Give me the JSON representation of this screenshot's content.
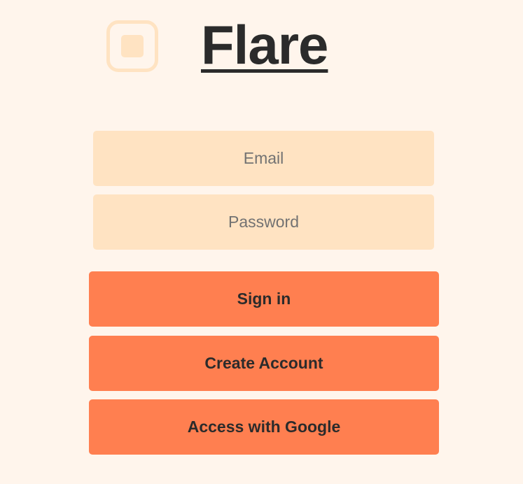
{
  "brand": {
    "name": "Flare",
    "icon": "rounded-square-icon"
  },
  "form": {
    "email_placeholder": "Email",
    "email_value": "",
    "password_placeholder": "Password",
    "password_value": ""
  },
  "buttons": {
    "sign_in": "Sign in",
    "create_account": "Create Account",
    "google": "Access with Google"
  },
  "colors": {
    "background": "#fff5ec",
    "field": "#ffe3c2",
    "button": "#ff7f50",
    "text": "#2b2b2b",
    "placeholder": "#727272"
  }
}
